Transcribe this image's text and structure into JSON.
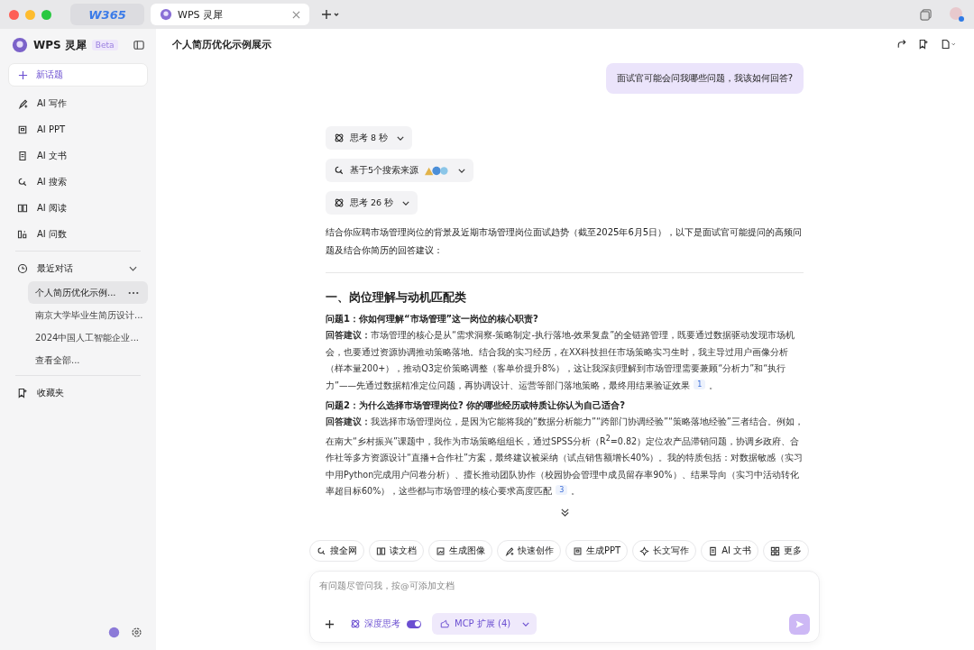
{
  "browser_tabs": [
    {
      "label": "W365",
      "kind": "logo",
      "selected": false
    },
    {
      "label": "WPS 灵犀",
      "kind": "page",
      "selected": true
    }
  ],
  "sidebar": {
    "brand": "WPS 灵犀",
    "badge": "Beta",
    "new_topic": "新话题",
    "items": [
      {
        "label": "AI 写作"
      },
      {
        "label": "AI PPT"
      },
      {
        "label": "AI 文书"
      },
      {
        "label": "AI 搜索"
      },
      {
        "label": "AI 阅读"
      },
      {
        "label": "AI 问数"
      }
    ],
    "recent_title": "最近对话",
    "recent": [
      {
        "label": "个人简历优化示例...",
        "selected": true
      },
      {
        "label": "南京大学毕业生简历设计...",
        "selected": false
      },
      {
        "label": "2024中国人工智能企业...",
        "selected": false
      },
      {
        "label": "查看全部...",
        "selected": false
      }
    ],
    "favorites": "收藏夹"
  },
  "header": {
    "title": "个人简历优化示例展示"
  },
  "user_message": "面试官可能会问我哪些问题，我该如何回答?",
  "steps": [
    {
      "kind": "think",
      "label": "思考 8 秒"
    },
    {
      "kind": "search",
      "label": "基于5个搜索来源"
    },
    {
      "kind": "think",
      "label": "思考 26 秒"
    }
  ],
  "intro": "结合你应聘市场管理岗位的背景及近期市场管理岗位面试趋势（截至2025年6月5日），以下是面试官可能提问的高频问题及结合你简历的回答建议：",
  "section_title": "一、岗位理解与动机匹配类",
  "qa": [
    {
      "question": "问题1：你如何理解“市场管理”这一岗位的核心职责?",
      "answer": "**回答建议：**市场管理的核心是从“需求洞察-策略制定-执行落地-效果复盘”的全链路管理，既要通过数据驱动发现市场机会，也要通过资源协调推动策略落地。结合我的实习经历，在XX科技担任市场策略实习生时，我主导过用户画像分析（样本量200+），推动Q3定价策略调整（客单价提升8%），这让我深刻理解到市场管理需要兼顾“分析力”和“执行力”——先通过数据精准定位问题，再协调设计、运营等部门落地策略，最终用结果验证效果",
      "citation": "1",
      "end": "。"
    },
    {
      "question": "问题2：为什么选择市场管理岗位? 你的哪些经历或特质让你认为自己适合?",
      "answer": "**回答建议：**我选择市场管理岗位，是因为它能将我的“数据分析能力”“跨部门协调经验”“策略落地经验”三者结合。例如，在南大“乡村振兴”课题中，我作为市场策略组组长，通过SPSS分析（R$^{2}$=0.82）定位农产品滞销问题，协调乡政府、合作社等多方资源设计“直播+合作社”方案，最终建议被采纳（试点销售额增长40%）。我的特质包括：对数据敏感（实习中用Python完成用户问卷分析）、擅长推动团队协作（校园协会管理中成员留存率90%）、结果导向（实习中活动转化率超目标60%），这些都与市场管理的核心要求高度匹配",
      "citation": "3",
      "end": "。"
    }
  ],
  "quick_actions": [
    {
      "label": "搜全网"
    },
    {
      "label": "读文档"
    },
    {
      "label": "生成图像"
    },
    {
      "label": "快速创作"
    },
    {
      "label": "生成PPT"
    },
    {
      "label": "长文写作"
    },
    {
      "label": "AI 文书"
    },
    {
      "label": "更多"
    }
  ],
  "composer": {
    "placeholder": "有问题尽管问我，按@可添加文档",
    "deep_think": {
      "label": "深度思考",
      "on": true
    },
    "mcp": "MCP 扩展 (4)"
  }
}
